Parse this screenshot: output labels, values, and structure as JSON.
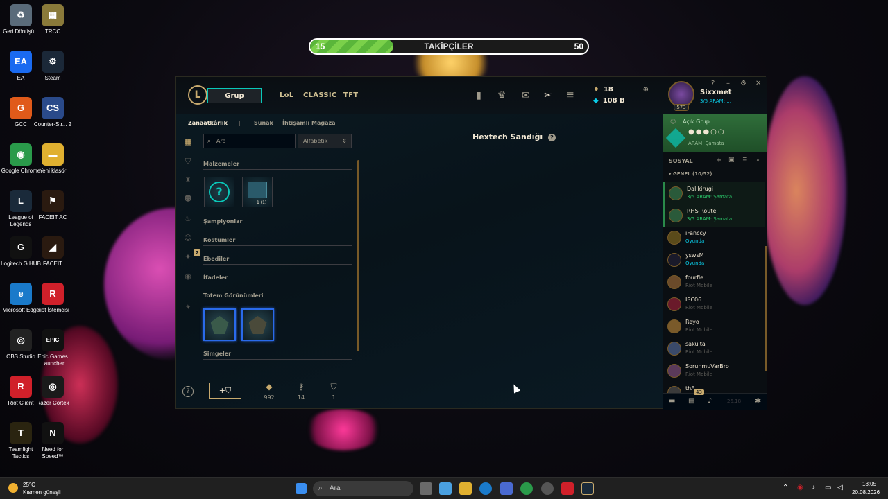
{
  "followers_bar": {
    "min": "15",
    "label": "TAKİPÇİLER",
    "max": "50",
    "progress_fraction": 0.3
  },
  "desktop": [
    {
      "label": "Geri Dönüşü...",
      "color": "#5a6b7a",
      "glyph": "♻"
    },
    {
      "label": "TRCC",
      "color": "#8a7a3a",
      "glyph": "▦"
    },
    {
      "label": "EA",
      "color": "#1a6af0",
      "glyph": "EA"
    },
    {
      "label": "Steam",
      "color": "#1b2838",
      "glyph": "⚙"
    },
    {
      "label": "GCC",
      "color": "#e05a1a",
      "glyph": "G"
    },
    {
      "label": "Counter-Str... 2",
      "color": "#2a4a8a",
      "glyph": "CS"
    },
    {
      "label": "Google Chrome",
      "color": "#2a9a4a",
      "glyph": "◉"
    },
    {
      "label": "Yeni klasör",
      "color": "#e0b030",
      "glyph": "▬"
    },
    {
      "label": "League of Legends",
      "color": "#1a2a3a",
      "glyph": "L"
    },
    {
      "label": "FACEIT AC",
      "color": "#2a1a10",
      "glyph": "⚑"
    },
    {
      "label": "Logitech G HUB",
      "color": "#111111",
      "glyph": "G"
    },
    {
      "label": "FACEIT",
      "color": "#2a1a10",
      "glyph": "◢"
    },
    {
      "label": "Microsoft Edge",
      "color": "#1a7aca",
      "glyph": "e"
    },
    {
      "label": "Riot İstemcisi",
      "color": "#d0202a",
      "glyph": "R"
    },
    {
      "label": "OBS Studio",
      "color": "#222222",
      "glyph": "◎"
    },
    {
      "label": "Epic Games Launcher",
      "color": "#111111",
      "glyph": "EPIC"
    },
    {
      "label": "Riot Client",
      "color": "#d0202a",
      "glyph": "R"
    },
    {
      "label": "Razer Cortex",
      "color": "#1a1a1a",
      "glyph": "◎"
    },
    {
      "label": "Teamfight Tactics",
      "color": "#2a2410",
      "glyph": "T"
    },
    {
      "label": "Need for Speed™",
      "color": "#111111",
      "glyph": "N"
    }
  ],
  "client": {
    "logo": "L",
    "play_button": "Grup",
    "tabs": [
      "LoL",
      "CLASSIC",
      "TFT"
    ],
    "currency": {
      "essence": "18",
      "rp": "108 B"
    },
    "profile": {
      "name": "Sixxmet",
      "level": "573",
      "status": "3/5 ARAM: ..."
    },
    "loot": {
      "tabs": [
        "Zanaatkârlık",
        "Sunak",
        "İhtişamlı Mağaza"
      ],
      "search_placeholder": "Ara",
      "sort": "Alfabetik",
      "sections": [
        "Malzemeler",
        "Şampiyonlar",
        "Kostümler",
        "Ebediler",
        "İfadeler",
        "Totem Görünümleri",
        "Simgeler"
      ],
      "material_badge": "1 (1)",
      "side_badge": "2",
      "bottom": {
        "essence": "992",
        "keys": "14",
        "chests": "1"
      }
    },
    "hextech_title": "Hextech Sandığı",
    "social": {
      "lobby_label": "Açık Grup",
      "lobby_mode": "ARAM: Şamata",
      "header": "SOSYAL",
      "group": "GENEL (10/52)",
      "badge": "43",
      "date": "26.18",
      "friends": [
        {
          "name": "Dalikirugi",
          "status": "3/5 ARAM: Şamata",
          "color": "#0acbe6",
          "tint": "#2a5a3a"
        },
        {
          "name": "RHS Route",
          "status": "3/5 ARAM: Şamata",
          "color": "#0acbe6",
          "tint": "#2a5a3a"
        },
        {
          "name": "iFanccy",
          "status": "Oyunda",
          "color": "#0acbe6",
          "tint": "#5a4a1a"
        },
        {
          "name": "yswsM",
          "status": "Oyunda",
          "color": "#0acbe6",
          "tint": "#1a1a2a"
        },
        {
          "name": "fourfle",
          "status": "Riot Mobile",
          "color": "#5b5a56",
          "tint": "#6a4a2a"
        },
        {
          "name": "ISC06",
          "status": "Riot Mobile",
          "color": "#5b5a56",
          "tint": "#6a1a2a"
        },
        {
          "name": "Reyo",
          "status": "Riot Mobile",
          "color": "#5b5a56",
          "tint": "#7a5a2a"
        },
        {
          "name": "sakulta",
          "status": "Riot Mobile",
          "color": "#5b5a56",
          "tint": "#3a4a6a"
        },
        {
          "name": "SorunmuVarBro",
          "status": "Riot Mobile",
          "color": "#5b5a56",
          "tint": "#5a3a5a"
        },
        {
          "name": "thA",
          "status": "",
          "color": "#5b5a56",
          "tint": "#3a3a3a"
        }
      ]
    }
  },
  "taskbar": {
    "weather_temp": "25°C",
    "weather_desc": "Kısmen güneşli",
    "search_placeholder": "Ara",
    "time": "18:05",
    "date": "20.08.2026"
  }
}
